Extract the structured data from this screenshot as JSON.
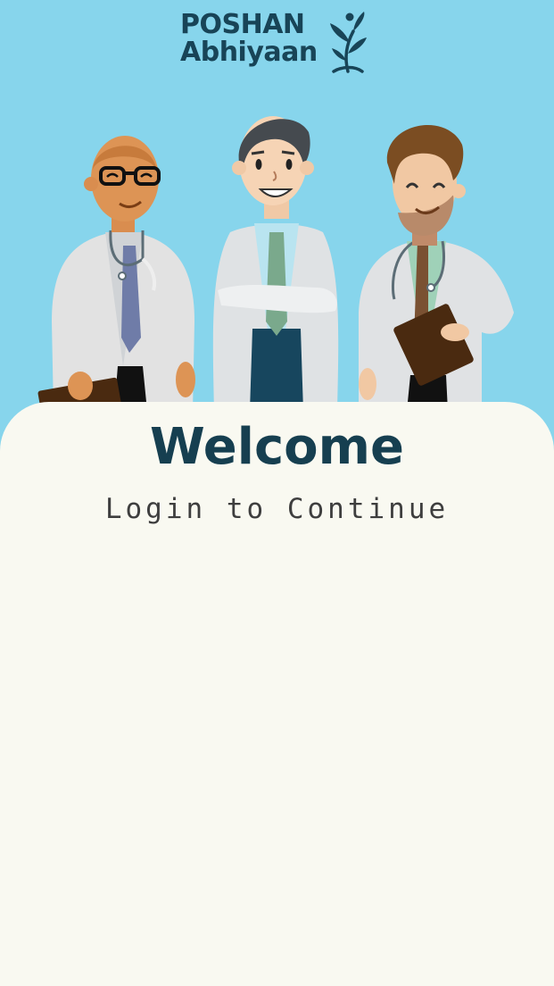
{
  "brand": {
    "line1": "POSHAN",
    "line2": "Abhiyaan",
    "mark_icon": "leaf-person-icon"
  },
  "illustration": {
    "icon": "doctors-group-illustration"
  },
  "login": {
    "title": "Welcome",
    "subtitle": "Login to Continue"
  },
  "colors": {
    "header_background": "#87d5ec",
    "card_background": "#f9f9f1",
    "title": "#163f50",
    "subtitle": "#3e3e3e",
    "brand": "#184457"
  }
}
